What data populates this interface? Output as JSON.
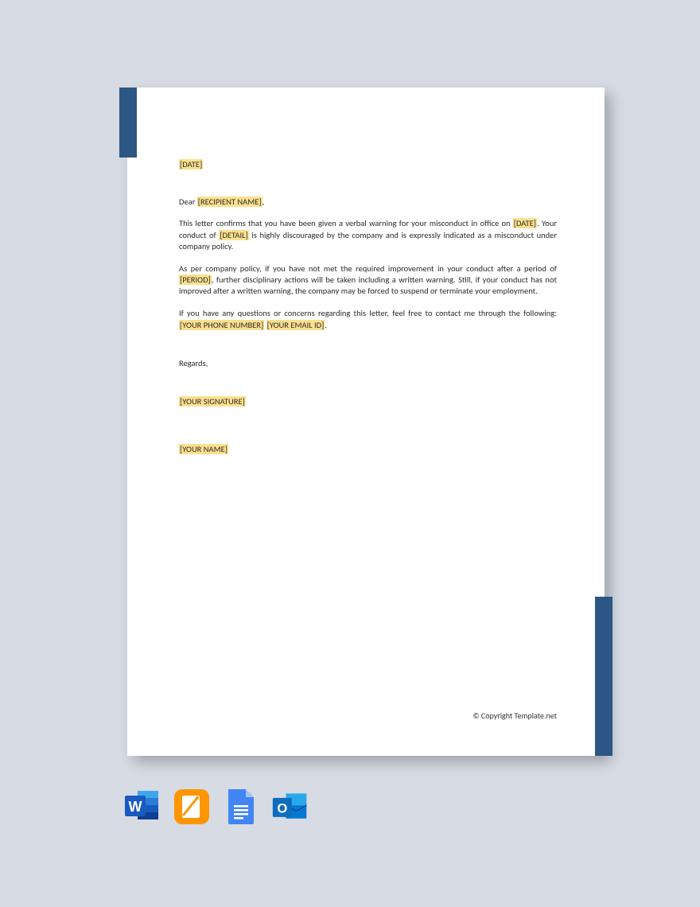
{
  "letter": {
    "date_ph": "[DATE]",
    "greeting_prefix": "Dear ",
    "recipient_ph": "[RECIPIENT NAME]",
    "greeting_suffix": ",",
    "p1a": "This letter confirms that you have been given a verbal warning for your misconduct in office on ",
    "p1_date_ph": "[DATE]",
    "p1b": ". Your conduct of ",
    "p1_detail_ph": "[DETAIL]",
    "p1c": " is highly discouraged by the company and is expressly indicated as a misconduct under company policy.",
    "p2a": "As per company policy, if you have not met the required improvement in your conduct after a period of ",
    "p2_period_ph": "[PERIOD]",
    "p2b": ", further disciplinary actions will be taken including a written warning. Still, if your conduct has not improved after a written warning, the company may be forced to suspend or terminate your employment.",
    "p3a": "If you have any questions or concerns regarding this letter, feel free to contact me through the following: ",
    "p3_phone_ph": "[YOUR PHONE NUMBER]",
    "p3_sep": " ",
    "p3_email_ph": "[YOUR EMAIL ID]",
    "p3b": ".",
    "regards": "Regards,",
    "signature_ph": "[YOUR SIGNATURE]",
    "yourname_ph": "[YOUR NAME]"
  },
  "footer": {
    "copyright": "© Copyright Template.net"
  },
  "icons": [
    {
      "name": "word",
      "label": "W"
    },
    {
      "name": "pages",
      "label": ""
    },
    {
      "name": "gdocs",
      "label": ""
    },
    {
      "name": "outlook",
      "label": "O"
    }
  ]
}
